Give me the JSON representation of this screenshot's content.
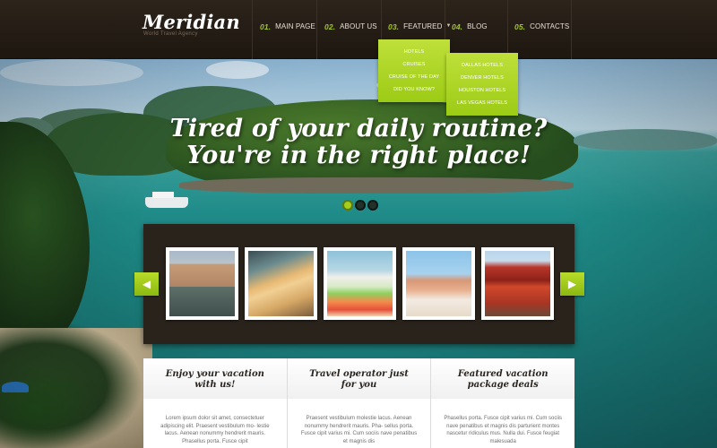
{
  "site": {
    "logo": "Meridian",
    "tagline": "World Travel Agency"
  },
  "nav": [
    {
      "num": "01.",
      "label": "MAIN PAGE",
      "has_caret": false
    },
    {
      "num": "02.",
      "label": "ABOUT US",
      "has_caret": false
    },
    {
      "num": "03.",
      "label": "FEATURED",
      "has_caret": true
    },
    {
      "num": "04.",
      "label": "BLOG",
      "has_caret": false
    },
    {
      "num": "05.",
      "label": "CONTACTS",
      "has_caret": false
    }
  ],
  "dropdown_featured": [
    "HOTELS",
    "CRUISES",
    "CRUISE OF THE DAY",
    "DID YOU KNOW?"
  ],
  "dropdown_hotels": [
    "DALLAS HOTELS",
    "DENVER HOTELS",
    "HOUSTON HOTELS",
    "LAS VEGAS HOTELS"
  ],
  "hero": {
    "headline_line1": "Tired of your daily routine?",
    "headline_line2": "You're in the right place!",
    "slide_count": 3,
    "active_slide": 1
  },
  "carousel": {
    "prev_icon": "chevron-left-icon",
    "next_icon": "chevron-right-icon",
    "thumbs": [
      "venice-canal",
      "tropical-beach-palm",
      "kayaks-boats",
      "couple-beach",
      "pagoda-temple"
    ]
  },
  "features": [
    {
      "title": "Enjoy your vacation with us!",
      "body": "Lorem ipsum dolor sit amet, consectetuer adipiscing elit. Praesent vestibulum mo- lestie lacus. Aenean nonummy hendrerit mauris. Phasellus porta. Fusce cipit"
    },
    {
      "title": "Travel operator just for you",
      "body": "Praesent vestibulum molestie lacus. Aenean nonummy hendrerit mauris. Pha- sellus porta. Fusce cipit varius mi. Cum sociis nave penatibus et magnis dis"
    },
    {
      "title": "Featured vacation package deals",
      "body": "Phasellus porta. Fusce cipit varius mi. Cum sociis nave penatibus et magnis dis parturient montes nascetur ridiculus mus. Nulla dui. Fusce feugiat malesuada"
    }
  ],
  "colors": {
    "accent": "#a6cd1c",
    "header_bg": "#2d241b",
    "sea": "#1f8b88"
  }
}
